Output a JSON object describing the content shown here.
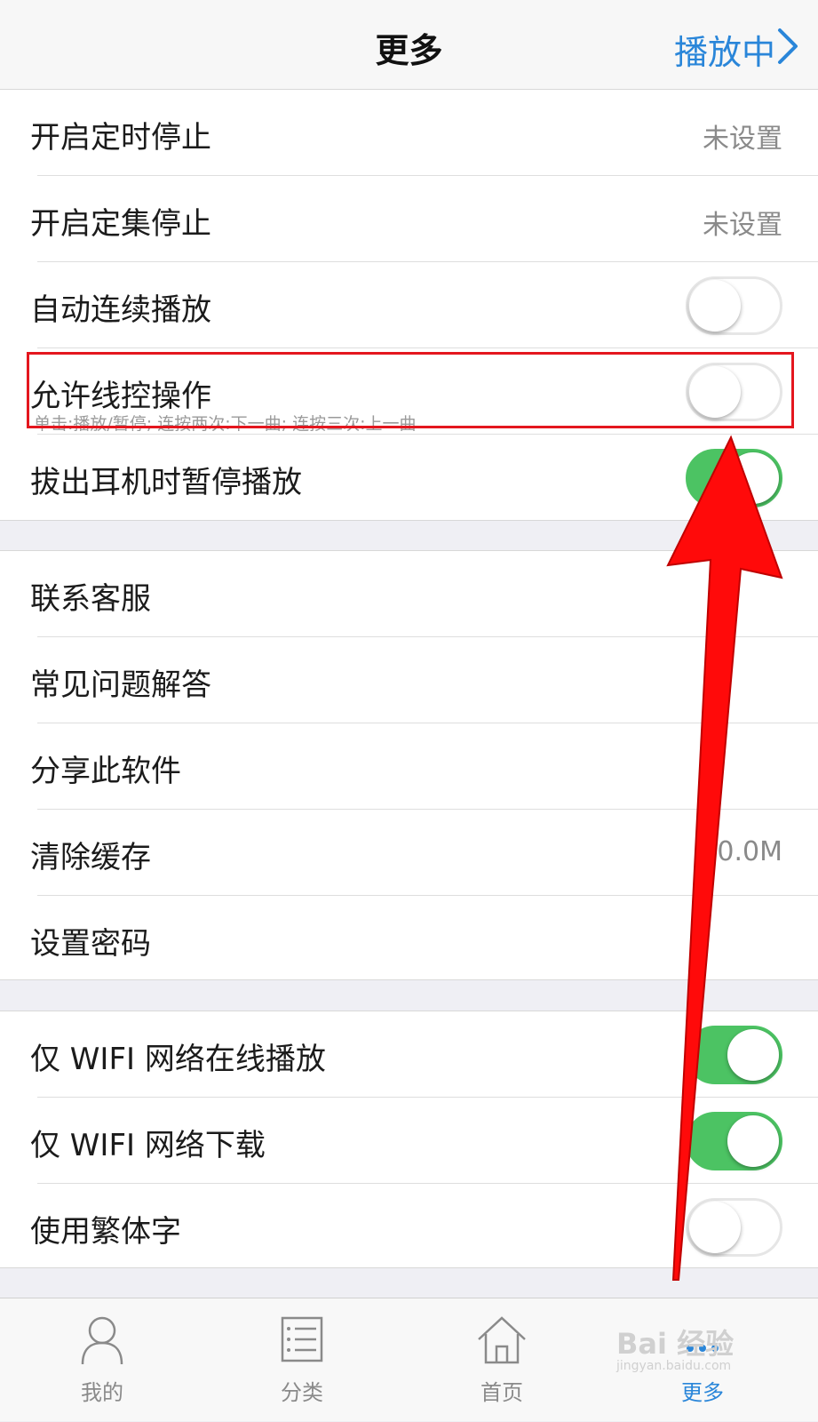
{
  "navbar": {
    "title": "更多",
    "right_label": "播放中"
  },
  "group1": {
    "rows": [
      {
        "label": "开启定时停止",
        "value": "未设置"
      },
      {
        "label": "开启定集停止",
        "value": "未设置"
      },
      {
        "label": "自动连续播放",
        "toggle": "off"
      },
      {
        "label": "允许线控操作",
        "sub": "单击:播放/暂停; 连按两次:下一曲; 连按三次:上一曲",
        "toggle": "off"
      },
      {
        "label": "拔出耳机时暂停播放",
        "toggle": "on"
      }
    ]
  },
  "group2": {
    "rows": [
      {
        "label": "联系客服"
      },
      {
        "label": "常见问题解答"
      },
      {
        "label": "分享此软件"
      },
      {
        "label": "清除缓存",
        "value": "0.0M"
      },
      {
        "label": "设置密码"
      }
    ]
  },
  "group3": {
    "rows": [
      {
        "label": "仅 WIFI 网络在线播放",
        "toggle": "on"
      },
      {
        "label": "仅 WIFI 网络下载",
        "toggle": "on"
      },
      {
        "label": "使用繁体字",
        "toggle": "off"
      }
    ]
  },
  "tabbar": {
    "tabs": [
      {
        "label": "我的",
        "icon": "person-icon"
      },
      {
        "label": "分类",
        "icon": "list-icon"
      },
      {
        "label": "首页",
        "icon": "home-icon"
      },
      {
        "label": "更多",
        "icon": "more-icon",
        "active": true
      }
    ]
  },
  "watermark": {
    "logo": "Bai 经验",
    "sub": "jingyan.baidu.com"
  },
  "colors": {
    "accent": "#2a86d9",
    "toggle_on": "#4cc363",
    "highlight": "#e4161e",
    "arrow": "#ff0a0a"
  }
}
